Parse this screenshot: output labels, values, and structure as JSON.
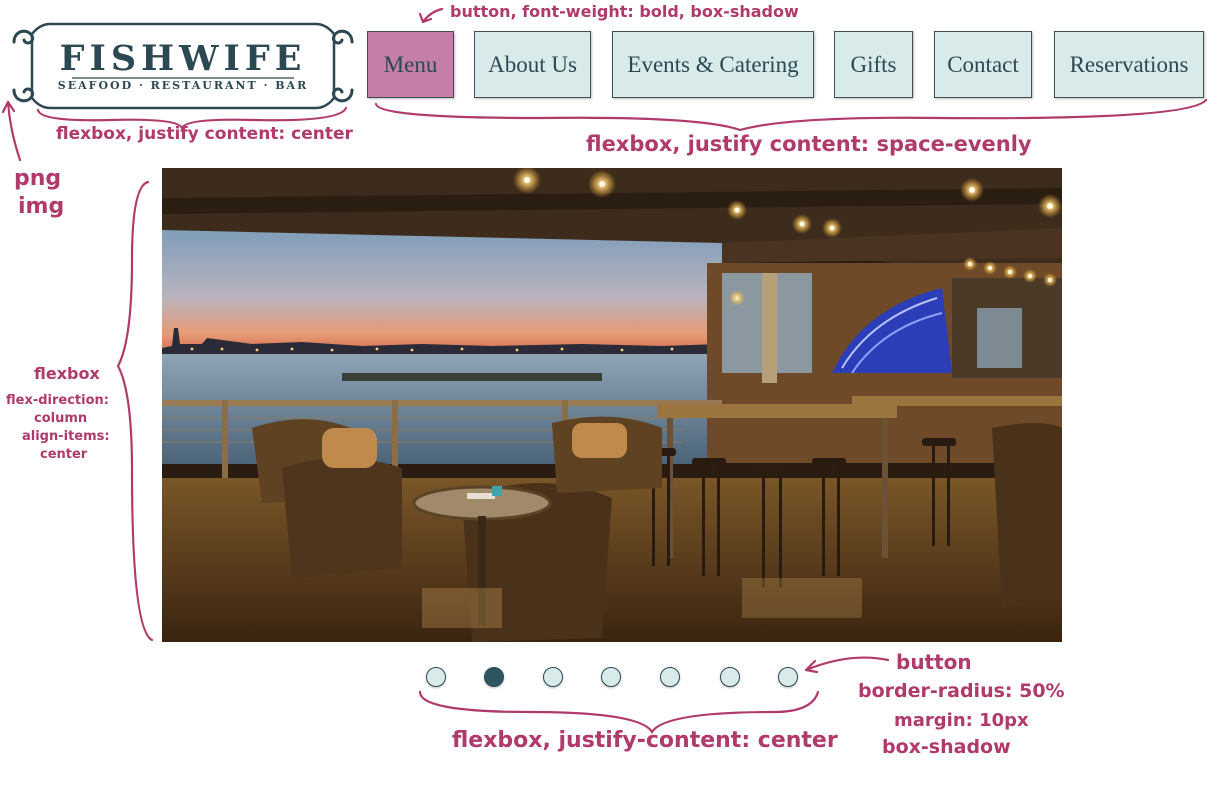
{
  "logo": {
    "title": "FISHWIFE",
    "subtitle": "SEAFOOD · RESTAURANT · BAR"
  },
  "nav": {
    "items": [
      {
        "label": "Menu",
        "active": true
      },
      {
        "label": "About Us",
        "active": false
      },
      {
        "label": "Events & Catering",
        "active": false
      },
      {
        "label": "Gifts",
        "active": false
      },
      {
        "label": "Contact",
        "active": false
      },
      {
        "label": "Reservations",
        "active": false
      }
    ]
  },
  "hero": {
    "image": "restaurant-terrace-sunset-photo"
  },
  "carousel": {
    "count": 7,
    "active_index": 1
  },
  "annotations": {
    "nav_button": "button, font-weight: bold, box-shadow",
    "logo_flex": "flexbox, justify content: center",
    "nav_flex": "flexbox, justify content: space-evenly",
    "png_1": "png",
    "png_2": "img",
    "col_flex_1": "flexbox",
    "col_flex_2": "flex-direction:",
    "col_flex_3": "column",
    "col_flex_4": "align-items:",
    "col_flex_5": "center",
    "dot_1": "button",
    "dot_2": "border-radius: 50%",
    "dot_3": "margin: 10px",
    "dot_4": "box-shadow",
    "dots_flex": "flexbox, justify-content: center"
  },
  "colors": {
    "accent": "#c37fa7",
    "button_bg": "#d8eaea",
    "dark_teal": "#2c4852",
    "annotation": "#b03a6c"
  }
}
